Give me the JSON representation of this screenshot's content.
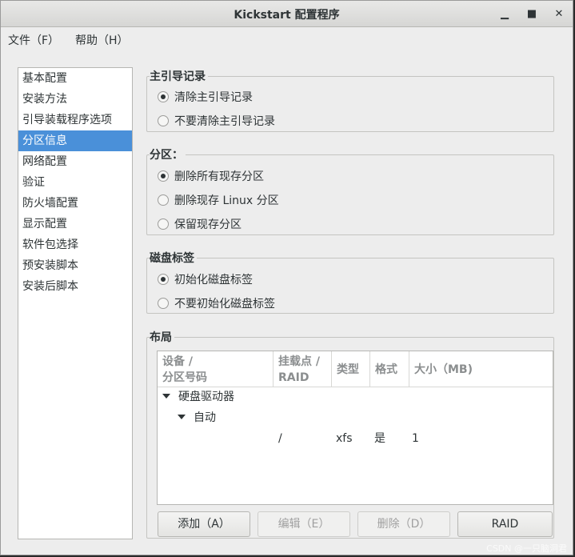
{
  "window": {
    "title": "Kickstart 配置程序",
    "minimize": "▁",
    "maximize": "■",
    "close": "✕"
  },
  "menu": {
    "file": "文件（F）",
    "help": "帮助（H）"
  },
  "sidebar": {
    "items": [
      {
        "label": "基本配置"
      },
      {
        "label": "安装方法"
      },
      {
        "label": "引导装载程序选项"
      },
      {
        "label": "分区信息",
        "selected": true
      },
      {
        "label": "网络配置"
      },
      {
        "label": "验证"
      },
      {
        "label": "防火墙配置"
      },
      {
        "label": "显示配置"
      },
      {
        "label": "软件包选择"
      },
      {
        "label": "预安装脚本"
      },
      {
        "label": "安装后脚本"
      }
    ]
  },
  "mbr": {
    "title": "主引导记录",
    "option_clear": "清除主引导记录",
    "option_keep": "不要清除主引导记录",
    "selected": "option_clear"
  },
  "partitions": {
    "title": "分区：",
    "option_remove_all": "删除所有现存分区",
    "option_remove_linux": "删除现存 Linux 分区",
    "option_preserve": "保留现存分区",
    "selected": "option_remove_all"
  },
  "disklabel": {
    "title": "磁盘标签",
    "option_init": "初始化磁盘标签",
    "option_no_init": "不要初始化磁盘标签",
    "selected": "option_init"
  },
  "layout": {
    "title": "布局",
    "columns": {
      "device_line1": "设备 /",
      "device_line2": "分区号码",
      "mount_line1": "挂载点 /",
      "mount_line2": "RAID",
      "type": "类型",
      "format": "格式",
      "size": "大小（MB)"
    },
    "tree": {
      "root": "硬盘驱动器",
      "child": "自动",
      "row": {
        "mount": "/",
        "type": "xfs",
        "format": "是",
        "size": "1"
      }
    },
    "buttons": {
      "add": "添加（A）",
      "edit": "编辑（E）",
      "delete": "删除（D）",
      "raid": "RAID"
    }
  },
  "watermark": "CSDN @一只脑洞君"
}
